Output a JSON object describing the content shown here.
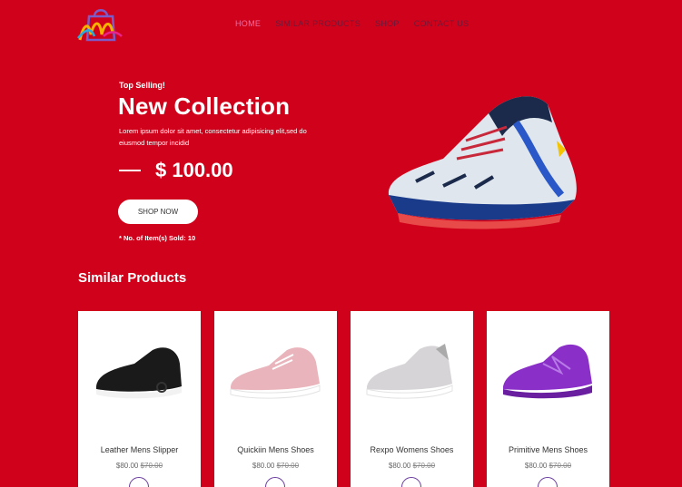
{
  "nav": [
    "HOME",
    "SIMILAR PRODUCTS",
    "SHOP",
    "CONTACT US"
  ],
  "hero": {
    "tag": "Top Selling!",
    "title": "New Collection",
    "description": "Lorem ipsum dolor sit amet, consectetur adipisicing elit,sed do eiusmod tempor incidid",
    "price": "$ 100.00",
    "button": "SHOP NOW",
    "sold": "* No. of Item(s) Sold: 10"
  },
  "similar": {
    "title": "Similar Products",
    "products": [
      {
        "name": "Leather Mens Slipper",
        "price": "$80.00",
        "old_price": "$70.00"
      },
      {
        "name": "Quickiin Mens Shoes",
        "price": "$80.00",
        "old_price": "$70.00"
      },
      {
        "name": "Rexpo Womens Shoes",
        "price": "$80.00",
        "old_price": "$70.00"
      },
      {
        "name": "Primitive Mens Shoes",
        "price": "$80.00",
        "old_price": "$70.00"
      }
    ]
  },
  "colors": {
    "background": "#d0021b",
    "accent": "#f06ea0",
    "nav": "#6a1a3a",
    "card": "#ffffff",
    "cart_ring": "#6b3fa0"
  },
  "icons": [
    "shopping-bag-logo-icon",
    "cart-icon"
  ]
}
